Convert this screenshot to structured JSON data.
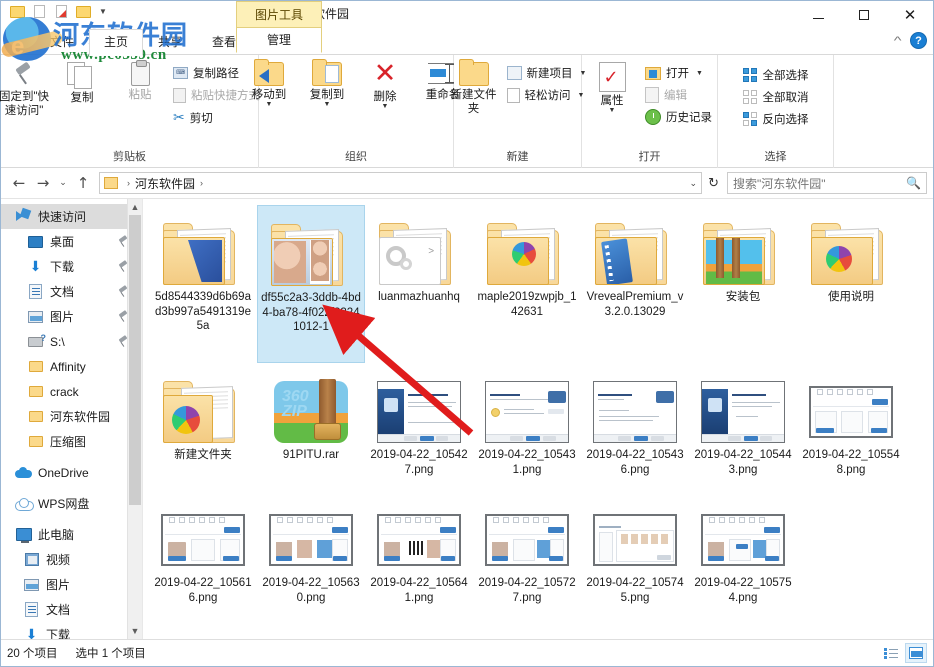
{
  "window": {
    "title": "河东软件园",
    "minimize_label": "最小化",
    "maximize_label": "最大化",
    "close_label": "关闭"
  },
  "quick_access_toolbar": {
    "items": [
      "新建文件夹",
      "属性",
      "自定义快速访问工具栏"
    ]
  },
  "tabs": [
    {
      "label": "文件",
      "active": false
    },
    {
      "label": "主页",
      "active": true
    },
    {
      "label": "共享",
      "active": false
    },
    {
      "label": "查看",
      "active": false
    }
  ],
  "contextual_tab": {
    "group_label": "图片工具",
    "tab_label": "管理"
  },
  "ribbon": {
    "collapse_label": "折叠功能区",
    "help_label": "?",
    "groups": [
      {
        "name": "剪贴板",
        "big_buttons": [
          {
            "label": "固定到\"快速访问\"",
            "icon": "pin-icon",
            "disabled": false
          },
          {
            "label": "复制",
            "icon": "copy-icon",
            "disabled": false
          },
          {
            "label": "粘贴",
            "icon": "paste-icon",
            "disabled": true
          }
        ],
        "small_buttons": [
          {
            "label": "复制路径",
            "icon": "copy-path-icon",
            "disabled": false
          },
          {
            "label": "粘贴快捷方式",
            "icon": "paste-shortcut-icon",
            "disabled": true
          },
          {
            "label": "剪切",
            "icon": "scissors-icon",
            "disabled": false
          }
        ]
      },
      {
        "name": "组织",
        "big_buttons": [
          {
            "label": "移动到",
            "icon": "move-to-icon",
            "has_dropdown": true
          },
          {
            "label": "复制到",
            "icon": "copy-to-icon",
            "has_dropdown": true
          },
          {
            "label": "删除",
            "icon": "delete-icon",
            "has_dropdown": true
          },
          {
            "label": "重命名",
            "icon": "rename-icon",
            "has_dropdown": false
          }
        ]
      },
      {
        "name": "新建",
        "big_buttons": [
          {
            "label": "新建文件夹",
            "icon": "new-folder-icon"
          }
        ],
        "small_buttons": [
          {
            "label": "新建项目",
            "icon": "new-item-icon",
            "has_dropdown": true
          },
          {
            "label": "轻松访问",
            "icon": "easy-access-icon",
            "has_dropdown": true
          }
        ]
      },
      {
        "name": "打开",
        "big_buttons": [
          {
            "label": "属性",
            "icon": "properties-icon",
            "has_dropdown": true
          }
        ],
        "small_buttons": [
          {
            "label": "打开",
            "icon": "open-icon",
            "has_dropdown": true
          },
          {
            "label": "编辑",
            "icon": "edit-icon",
            "disabled": true
          },
          {
            "label": "历史记录",
            "icon": "history-icon"
          }
        ]
      },
      {
        "name": "选择",
        "small_buttons": [
          {
            "label": "全部选择",
            "icon": "select-all-icon"
          },
          {
            "label": "全部取消",
            "icon": "select-none-icon"
          },
          {
            "label": "反向选择",
            "icon": "invert-selection-icon"
          }
        ]
      }
    ]
  },
  "addressbar": {
    "back_label": "后退",
    "forward_label": "前进",
    "recent_label": "最近浏览的位置",
    "up_label": "上移一级",
    "crumbs": [
      "河东软件园"
    ],
    "refresh_label": "刷新",
    "dropdown_label": "展开"
  },
  "search": {
    "placeholder": "搜索\"河东软件园\"",
    "value": "",
    "icon": "search-icon"
  },
  "navpane": {
    "items": [
      {
        "label": "快速访问",
        "icon": "quick-access-icon",
        "level": 1,
        "selected": true,
        "pinned": false
      },
      {
        "label": "桌面",
        "icon": "desktop-icon",
        "level": 2,
        "pinned": true
      },
      {
        "label": "下载",
        "icon": "downloads-icon",
        "level": 2,
        "pinned": true
      },
      {
        "label": "文档",
        "icon": "documents-icon",
        "level": 2,
        "pinned": true
      },
      {
        "label": "图片",
        "icon": "pictures-icon",
        "level": 2,
        "pinned": true
      },
      {
        "label": "S:\\",
        "icon": "drive-icon",
        "level": 2,
        "pinned": true
      },
      {
        "label": "Affinity",
        "icon": "folder-icon",
        "level": 2,
        "pinned": false
      },
      {
        "label": "crack",
        "icon": "folder-icon",
        "level": 2,
        "pinned": false
      },
      {
        "label": "河东软件园",
        "icon": "folder-icon",
        "level": 2,
        "pinned": false
      },
      {
        "label": "压缩图",
        "icon": "folder-icon",
        "level": 2,
        "pinned": false
      },
      {
        "label": "OneDrive",
        "icon": "onedrive-icon",
        "level": 1,
        "pinned": false
      },
      {
        "label": "WPS网盘",
        "icon": "wps-cloud-icon",
        "level": 1,
        "pinned": false
      },
      {
        "label": "此电脑",
        "icon": "this-pc-icon",
        "level": 1,
        "pinned": false
      },
      {
        "label": "视频",
        "icon": "videos-icon",
        "level": 3,
        "pinned": false
      },
      {
        "label": "图片",
        "icon": "pictures-icon",
        "level": 3,
        "pinned": false
      },
      {
        "label": "文档",
        "icon": "documents-icon",
        "level": 3,
        "pinned": false
      },
      {
        "label": "下载",
        "icon": "downloads-icon",
        "level": 3,
        "pinned": false
      }
    ]
  },
  "files": [
    {
      "name": "5d8544339d6b69ad3b997a5491319e5a",
      "kind": "folder",
      "art": "blue",
      "selected": false
    },
    {
      "name": "df55c2a3-3ddb-4bd4-ba78-4f022f83241012-1",
      "kind": "folder",
      "art": "face",
      "selected": true
    },
    {
      "name": "luanmazhuanhq",
      "kind": "folder",
      "art": "gear",
      "selected": false
    },
    {
      "name": "maple2019zwpjb_142631",
      "kind": "folder",
      "art": "pie",
      "selected": false
    },
    {
      "name": "VrevealPremium_v3.2.0.13029",
      "kind": "folder",
      "art": "film",
      "selected": false
    },
    {
      "name": "安装包",
      "kind": "folder",
      "art": "luggage",
      "selected": false
    },
    {
      "name": "使用说明",
      "kind": "folder",
      "art": "pie",
      "selected": false
    },
    {
      "name": "新建文件夹",
      "kind": "folder",
      "art": "pie-small",
      "selected": false
    },
    {
      "name": "91PITU.rar",
      "kind": "archive",
      "art": "rar",
      "selected": false
    },
    {
      "name": "2019-04-22_105427.png",
      "kind": "image",
      "art": "installer-blue",
      "selected": false
    },
    {
      "name": "2019-04-22_105431.png",
      "kind": "image",
      "art": "dialog-warn",
      "selected": false
    },
    {
      "name": "2019-04-22_105436.png",
      "kind": "image",
      "art": "dialog-plain",
      "selected": false
    },
    {
      "name": "2019-04-22_105443.png",
      "kind": "image",
      "art": "installer-blue",
      "selected": false
    },
    {
      "name": "2019-04-22_105548.png",
      "kind": "image",
      "art": "app-ui",
      "selected": false
    },
    {
      "name": "2019-04-22_105616.png",
      "kind": "image",
      "art": "app-ui",
      "selected": false
    },
    {
      "name": "2019-04-22_105630.png",
      "kind": "image",
      "art": "app-ui-photos",
      "selected": false
    },
    {
      "name": "2019-04-22_105641.png",
      "kind": "image",
      "art": "app-ui-qr",
      "selected": false
    },
    {
      "name": "2019-04-22_105727.png",
      "kind": "image",
      "art": "app-ui-photos",
      "selected": false
    },
    {
      "name": "2019-04-22_105745.png",
      "kind": "image",
      "art": "app-ui-browse",
      "selected": false
    },
    {
      "name": "2019-04-22_105754.png",
      "kind": "image",
      "art": "app-ui-photos",
      "selected": false
    }
  ],
  "statusbar": {
    "item_count": "20 个项目",
    "selection": "选中 1 个项目",
    "view_details_label": "详细信息视图",
    "view_large_label": "大图标视图"
  },
  "watermark": {
    "site": "河东软件园",
    "url": "www.pc0359.cn"
  },
  "colors": {
    "accent": "#1a7fd4",
    "selection": "#cde8f7",
    "contextual_tab": "#fdf0b8",
    "arrow": "#e01c1c",
    "folder": "#fbd98a"
  }
}
